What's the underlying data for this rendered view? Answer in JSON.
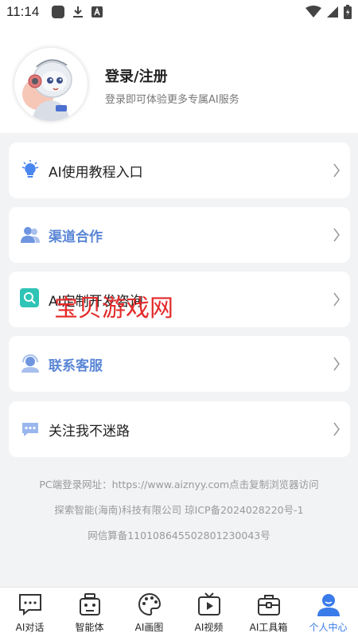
{
  "status_bar": {
    "time": "11:14"
  },
  "profile": {
    "title": "登录/注册",
    "subtitle": "登录即可体验更多专属AI服务"
  },
  "menu": [
    {
      "label": "AI使用教程入口",
      "icon": "lightbulb-icon",
      "style": "normal"
    },
    {
      "label": "渠道合作",
      "icon": "users-icon",
      "style": "blue"
    },
    {
      "label": "AI定制开发咨询",
      "icon": "search-icon",
      "style": "normal"
    },
    {
      "label": "联系客服",
      "icon": "headset-icon",
      "style": "blue"
    },
    {
      "label": "关注我不迷路",
      "icon": "chat-bubble-icon",
      "style": "normal"
    }
  ],
  "watermark": "宝贝游戏网",
  "footer": {
    "line1": "PC端登录网址：https://www.aiznyy.com点击复制浏览器访问",
    "line2": "探索智能(海南)科技有限公司 琼ICP备2024028220号-1",
    "line3": "网信算备110108645502801230043号"
  },
  "nav": [
    {
      "label": "AI对话",
      "icon": "chat-icon",
      "active": false
    },
    {
      "label": "智能体",
      "icon": "robot-icon",
      "active": false
    },
    {
      "label": "AI画图",
      "icon": "palette-icon",
      "active": false
    },
    {
      "label": "AI视频",
      "icon": "video-icon",
      "active": false
    },
    {
      "label": "AI工具箱",
      "icon": "toolbox-icon",
      "active": false
    },
    {
      "label": "个人中心",
      "icon": "profile-icon",
      "active": true
    }
  ],
  "colors": {
    "accent": "#3a7bea",
    "blue_label": "#5a86d6",
    "watermark": "#e42a2a",
    "teal": "#2ec4b6"
  }
}
